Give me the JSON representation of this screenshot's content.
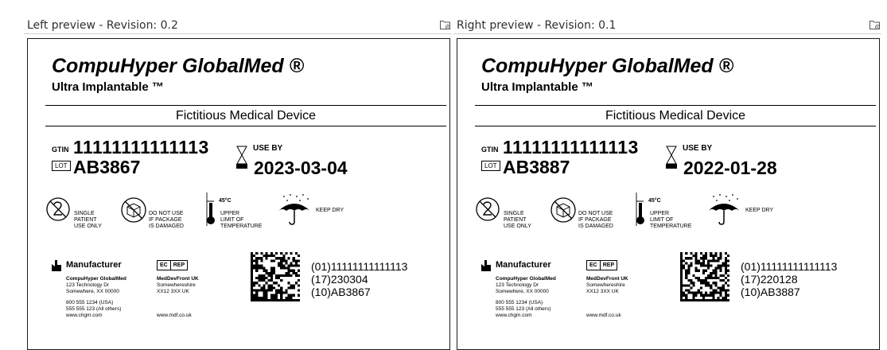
{
  "panes": {
    "left": {
      "title": "Left preview - Revision: 0.2",
      "brand": "CompuHyper GlobalMed ®",
      "product": "Ultra Implantable ™",
      "description": "Fictitious Medical Device",
      "gtin_label": "GTIN",
      "gtin": "11111111111113",
      "lot_label": "LOT",
      "lot": "AB3867",
      "use_by_label": "USE BY",
      "use_by": "2023-03-04",
      "symbols": {
        "single_patient": [
          "SINGLE",
          "PATIENT",
          "USE ONLY"
        ],
        "do_not_use": [
          "DO NOT USE",
          "IF PACKAGE",
          "IS DAMAGED"
        ],
        "temp_value": "45°C",
        "temperature": [
          "UPPER",
          "LIMIT OF",
          "TEMPERATURE"
        ],
        "keep_dry": "KEEP DRY"
      },
      "manufacturer": {
        "title": "Manufacturer",
        "name": "CompuHyper GlobalMed",
        "address1": "123 Technology Dr",
        "address2": "Somewhere, XX 00000",
        "phone1": "800 555 1234 (USA)",
        "phone2": "555 555 123 (All others)",
        "web": "www.chgm.com"
      },
      "rep": {
        "ec": "EC",
        "rep": "REP",
        "name": "MedDevFront UK",
        "address1": "Somewhereshire",
        "address2": "XX12 3XX UK",
        "web": "www.mdf.co.uk"
      },
      "udi": [
        "(01)11111111111113",
        "(17)230304",
        "(10)AB3867"
      ]
    },
    "right": {
      "title": "Right preview - Revision: 0.1",
      "brand": "CompuHyper GlobalMed ®",
      "product": "Ultra Implantable ™",
      "description": "Fictitious Medical Device",
      "gtin_label": "GTIN",
      "gtin": "11111111111113",
      "lot_label": "LOT",
      "lot": "AB3887",
      "use_by_label": "USE BY",
      "use_by": "2022-01-28",
      "symbols": {
        "single_patient": [
          "SINGLE",
          "PATIENT",
          "USE ONLY"
        ],
        "do_not_use": [
          "DO NOT USE",
          "IF PACKAGE",
          "IS DAMAGED"
        ],
        "temp_value": "45°C",
        "temperature": [
          "UPPER",
          "LIMIT OF",
          "TEMPERATURE"
        ],
        "keep_dry": "KEEP DRY"
      },
      "manufacturer": {
        "title": "Manufacturer",
        "name": "CompuHyper GlobalMed",
        "address1": "123 Technology Dr",
        "address2": "Somewhere, XX 00000",
        "phone1": "800 555 1234 (USA)",
        "phone2": "555 555 123 (All others)",
        "web": "www.chgm.com"
      },
      "rep": {
        "ec": "EC",
        "rep": "REP",
        "name": "MedDevFront UK",
        "address1": "Somewhereshire",
        "address2": "XX12 3XX UK",
        "web": "www.mdf.co.uk"
      },
      "udi": [
        "(01)11111111111113",
        "(17)220128",
        "(10)AB3887"
      ]
    }
  },
  "icons": {
    "folder": "open-folder-icon",
    "single_use": "single-use-icon",
    "do_not_use": "do-not-use-if-damaged-icon",
    "thermometer": "thermometer-icon",
    "umbrella": "keep-dry-icon",
    "hourglass": "hourglass-icon",
    "manufacturer": "manufacturer-icon",
    "datamatrix": "datamatrix-barcode"
  }
}
